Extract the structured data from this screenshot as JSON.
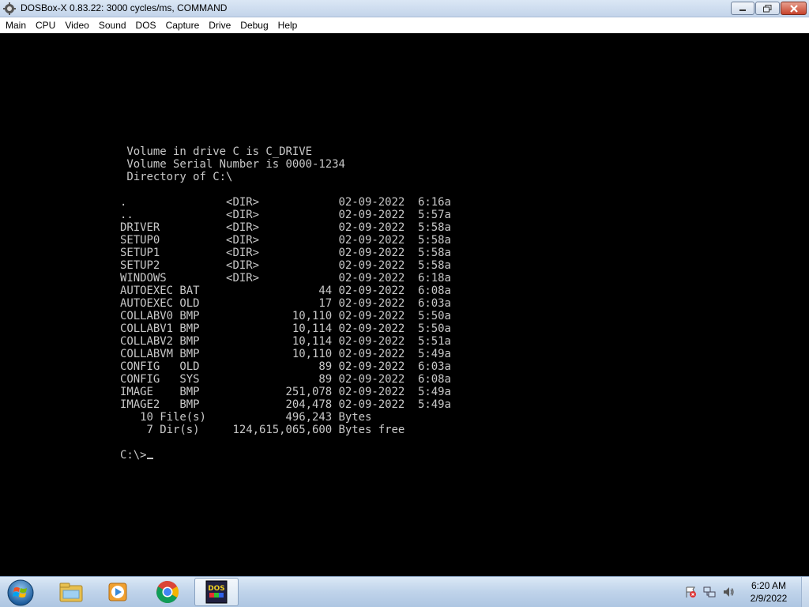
{
  "window": {
    "title": "DOSBox-X 0.83.22: 3000 cycles/ms, COMMAND"
  },
  "menu": [
    "Main",
    "CPU",
    "Video",
    "Sound",
    "DOS",
    "Capture",
    "Drive",
    "Debug",
    "Help"
  ],
  "console": {
    "lines": [
      " Volume in drive C is C_DRIVE",
      " Volume Serial Number is 0000-1234",
      " Directory of C:\\",
      "",
      ".               <DIR>            02-09-2022  6:16a",
      "..              <DIR>            02-09-2022  5:57a",
      "DRIVER          <DIR>            02-09-2022  5:58a",
      "SETUP0          <DIR>            02-09-2022  5:58a",
      "SETUP1          <DIR>            02-09-2022  5:58a",
      "SETUP2          <DIR>            02-09-2022  5:58a",
      "WINDOWS         <DIR>            02-09-2022  6:18a",
      "AUTOEXEC BAT                  44 02-09-2022  6:08a",
      "AUTOEXEC OLD                  17 02-09-2022  6:03a",
      "COLLABV0 BMP              10,110 02-09-2022  5:50a",
      "COLLABV1 BMP              10,114 02-09-2022  5:50a",
      "COLLABV2 BMP              10,114 02-09-2022  5:51a",
      "COLLABVM BMP              10,110 02-09-2022  5:49a",
      "CONFIG   OLD                  89 02-09-2022  6:03a",
      "CONFIG   SYS                  89 02-09-2022  6:08a",
      "IMAGE    BMP             251,078 02-09-2022  5:49a",
      "IMAGE2   BMP             204,478 02-09-2022  5:49a",
      "   10 File(s)            496,243 Bytes",
      "    7 Dir(s)     124,615,065,600 Bytes free",
      ""
    ],
    "prompt": "C:\\>"
  },
  "taskbar": {
    "clock_time": "6:20 AM",
    "clock_date": "2/9/2022",
    "dosbox_label": "DOS"
  },
  "colors": {
    "console_text": "#c8c8c8",
    "console_bg": "#000000",
    "taskbar": "#bfd3ea"
  },
  "icons": [
    "dosbox-app-icon",
    "minimize-icon",
    "maximize-icon",
    "close-icon",
    "windows-start-icon",
    "file-explorer-icon",
    "media-player-icon",
    "chrome-icon",
    "dosbox-icon",
    "action-center-icon",
    "network-icon",
    "volume-icon"
  ]
}
